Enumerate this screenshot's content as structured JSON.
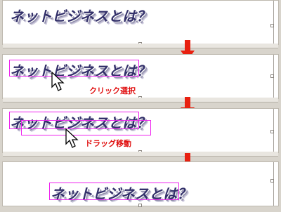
{
  "steps": [
    {
      "wordart_text": "ネットビジネスとは？"
    },
    {
      "wordart_text": "ネットビジネスとは？",
      "caption": "クリック選択"
    },
    {
      "wordart_text": "ネットビジネスとは？",
      "caption": "ドラッグ移動"
    },
    {
      "wordart_text": "ネットビジネスとは？"
    }
  ],
  "colors": {
    "arrow": "#e82010",
    "selection": "#ee22ee",
    "caption": "#e01010",
    "wordart": "#33306a"
  },
  "icons": [
    "arrow-cursor-icon",
    "down-arrow-icon",
    "resize-handle-icon"
  ]
}
